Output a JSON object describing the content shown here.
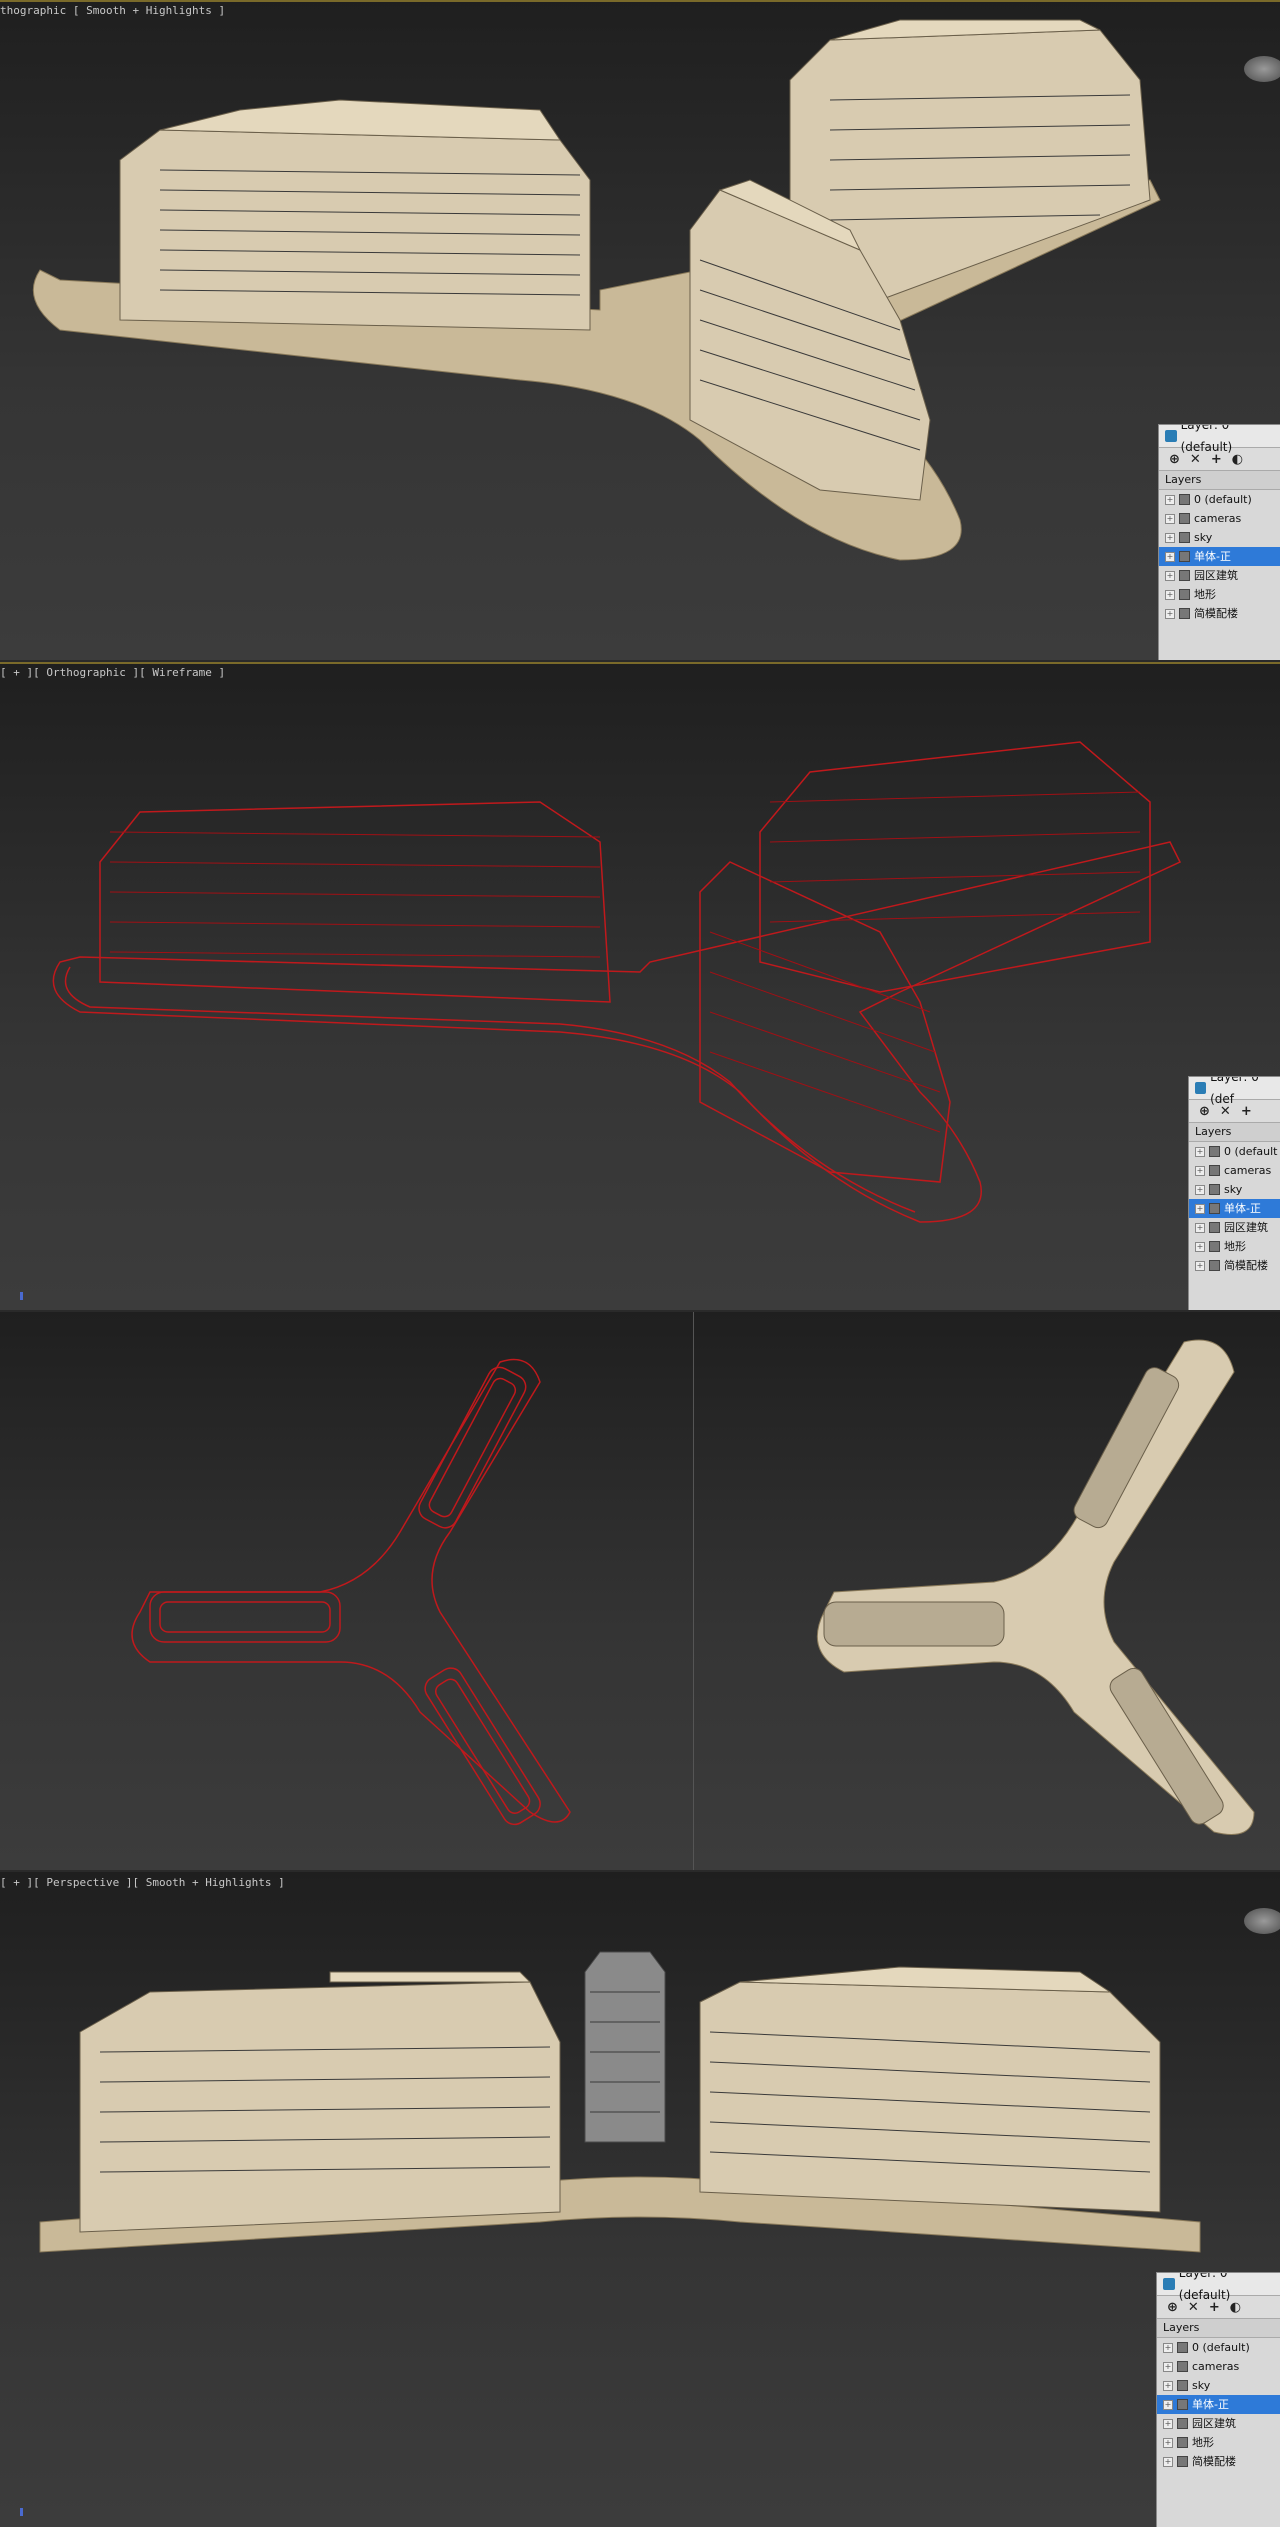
{
  "viewports": {
    "top": {
      "label": "thographic [ Smooth + Highlights ]"
    },
    "wire": {
      "label": "[ + ][ Orthographic ][ Wireframe ]"
    },
    "bottom": {
      "label": "[ + ][ Perspective ][ Smooth + Highlights ]"
    }
  },
  "layer_panel": {
    "title": "Layer: 0 (default)",
    "title_short": "Layer: 0 (def",
    "tools": [
      "⊕",
      "✕",
      "+",
      "◐"
    ],
    "header": "Layers",
    "header_short": "Layers",
    "items": [
      "0 (default)",
      "cameras",
      "sky",
      "单体-正",
      "园区建筑",
      "地形",
      "简模配楼"
    ],
    "items_short": [
      "0 (default",
      "cameras",
      "sky",
      "单体-正",
      "园区建筑",
      "地形",
      "简模配楼"
    ],
    "selected_index": 3
  },
  "colors": {
    "building": "#d8cbb0",
    "wire": "#c0191c",
    "selection": "#2e7ad8",
    "viewport_active_border": "#7a6a2a"
  }
}
